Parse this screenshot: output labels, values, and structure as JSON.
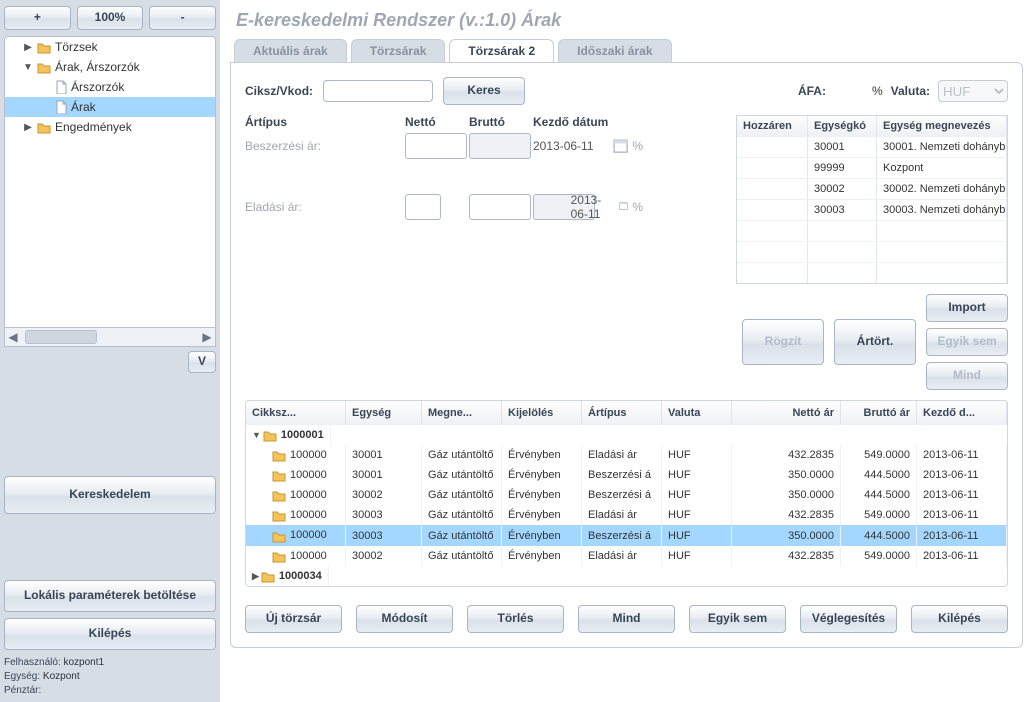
{
  "title": "E-kereskedelmi Rendszer (v.:1.0)   Árak",
  "zoom": {
    "plus": "+",
    "level": "100%",
    "minus": "-"
  },
  "tree": {
    "items": [
      {
        "label": "Törzsek",
        "icon": "folder",
        "state": "closed",
        "level": 0
      },
      {
        "label": "Árak, Árszorzók",
        "icon": "folder",
        "state": "open",
        "level": 0
      },
      {
        "label": "Árszorzók",
        "icon": "doc",
        "state": "",
        "level": 1
      },
      {
        "label": "Árak",
        "icon": "doc",
        "state": "",
        "level": 1,
        "selected": true
      },
      {
        "label": "Engedmények",
        "icon": "folder",
        "state": "closed",
        "level": 0
      }
    ],
    "v_button": "V"
  },
  "side_buttons": {
    "market": "Kereskedelem",
    "load_params": "Lokális paraméterek betöltése",
    "exit": "Kilépés"
  },
  "status": {
    "user_key": "Felhasználó:",
    "user_val": "kozpont1",
    "unit_key": "Egység:",
    "unit_val": "Kozpont",
    "till_key": "Pénztár:",
    "till_val": ""
  },
  "tabs": [
    {
      "label": "Aktuális árak",
      "active": false
    },
    {
      "label": "Törzsárak",
      "active": false
    },
    {
      "label": "Törzsárak 2",
      "active": true
    },
    {
      "label": "Időszaki árak",
      "active": false
    }
  ],
  "filter": {
    "ciksz_label": "Ciksz/Vkod:",
    "search": "Keres",
    "afa_label": "ÁFA:",
    "afa_pct": "%",
    "valuta_label": "Valuta:",
    "valuta_value": "HUF"
  },
  "price_form": {
    "head_type": "Ártípus",
    "head_net": "Nettó",
    "head_gross": "Bruttó",
    "head_date": "Kezdő dátum",
    "row1_label": "Beszerzési ár:",
    "row1_date": "2013-06-11",
    "row1_pct": "%",
    "row2_label": "Eladási ár:",
    "row2_date": "2013-06-11",
    "row2_pct": "%"
  },
  "unit_table": {
    "h1": "Hozzáren",
    "h2": "Egységkó",
    "h3": "Egység megnevezés",
    "rows": [
      {
        "c1": "",
        "c2": "30001",
        "c3": "30001. Nemzeti dohányb"
      },
      {
        "c1": "",
        "c2": "99999",
        "c3": "Kozpont"
      },
      {
        "c1": "",
        "c2": "30002",
        "c3": "30002. Nemzeti dohányb"
      },
      {
        "c1": "",
        "c2": "30003",
        "c3": "30003. Nemzeti dohányb"
      }
    ]
  },
  "mid_buttons": {
    "import": "Import",
    "record": "Rögzít",
    "hist": "Ártört.",
    "none": "Egyik sem",
    "all": "Mind"
  },
  "grid": {
    "headers": {
      "cik": "Cikksz...",
      "egy": "Egység",
      "meg": "Megne...",
      "kij": "Kijelölés",
      "art": "Ártípus",
      "val": "Valuta",
      "net": "Nettó ár",
      "bru": "Bruttó ár",
      "dat": "Kezdő d..."
    },
    "rows": [
      {
        "group": true,
        "open": true,
        "cik": "1000001"
      },
      {
        "cik": "100000",
        "egy": "30001",
        "meg": "Gáz utántöltő",
        "kij": "Érvényben",
        "art": "Eladási ár",
        "val": "HUF",
        "net": "432.2835",
        "bru": "549.0000",
        "dat": "2013-06-11"
      },
      {
        "cik": "100000",
        "egy": "30001",
        "meg": "Gáz utántöltő",
        "kij": "Érvényben",
        "art": "Beszerzési á",
        "val": "HUF",
        "net": "350.0000",
        "bru": "444.5000",
        "dat": "2013-06-11"
      },
      {
        "cik": "100000",
        "egy": "30002",
        "meg": "Gáz utántöltő",
        "kij": "Érvényben",
        "art": "Beszerzési á",
        "val": "HUF",
        "net": "350.0000",
        "bru": "444.5000",
        "dat": "2013-06-11"
      },
      {
        "cik": "100000",
        "egy": "30003",
        "meg": "Gáz utántöltő",
        "kij": "Érvényben",
        "art": "Eladási ár",
        "val": "HUF",
        "net": "432.2835",
        "bru": "549.0000",
        "dat": "2013-06-11"
      },
      {
        "cik": "100000",
        "egy": "30003",
        "meg": "Gáz utántöltő",
        "kij": "Érvényben",
        "art": "Beszerzési á",
        "val": "HUF",
        "net": "350.0000",
        "bru": "444.5000",
        "dat": "2013-06-11",
        "selected": true
      },
      {
        "cik": "100000",
        "egy": "30002",
        "meg": "Gáz utántöltő",
        "kij": "Érvényben",
        "art": "Eladási ár",
        "val": "HUF",
        "net": "432.2835",
        "bru": "549.0000",
        "dat": "2013-06-11"
      },
      {
        "group": true,
        "open": false,
        "cik": "1000034"
      }
    ]
  },
  "bottom": {
    "new": "Új törzsár",
    "mod": "Módosít",
    "del": "Törlés",
    "all": "Mind",
    "none": "Egyik sem",
    "final": "Véglegesítés",
    "exit": "Kilépés"
  }
}
